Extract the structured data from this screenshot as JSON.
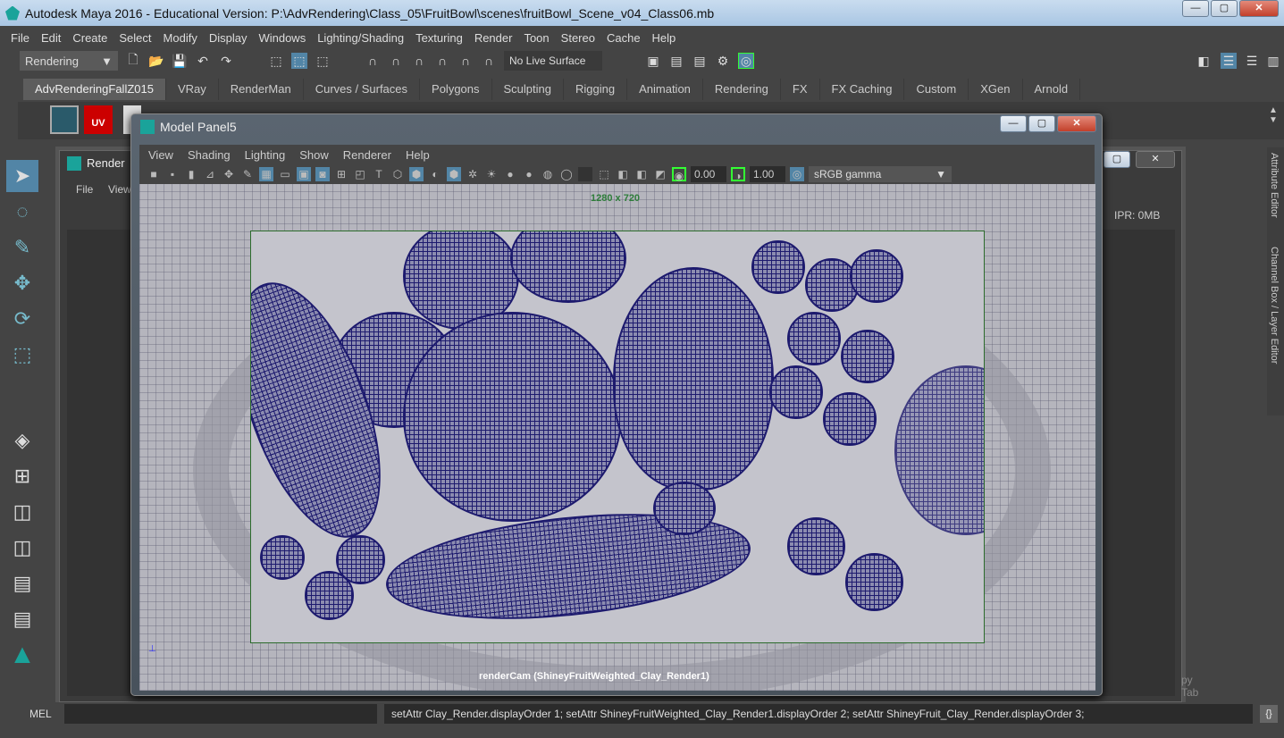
{
  "app": {
    "title": "Autodesk Maya 2016 - Educational Version: P:\\AdvRendering\\Class_05\\FruitBowl\\scenes\\fruitBowl_Scene_v04_Class06.mb"
  },
  "menu": [
    "File",
    "Edit",
    "Create",
    "Select",
    "Modify",
    "Display",
    "Windows",
    "Lighting/Shading",
    "Texturing",
    "Render",
    "Toon",
    "Stereo",
    "Cache",
    "Help"
  ],
  "toolbar": {
    "menu_set": "Rendering",
    "live_surface": "No Live Surface"
  },
  "shelf_tabs": [
    "AdvRenderingFallZ015",
    "VRay",
    "RenderMan",
    "Curves / Surfaces",
    "Polygons",
    "Sculpting",
    "Rigging",
    "Animation",
    "Rendering",
    "FX",
    "FX Caching",
    "Custom",
    "XGen",
    "Arnold"
  ],
  "render_window": {
    "title": "Render",
    "menu": [
      "File",
      "View"
    ],
    "mem": "IPR: 0MB"
  },
  "model_panel": {
    "title": "Model Panel5",
    "menu": [
      "View",
      "Shading",
      "Lighting",
      "Show",
      "Renderer",
      "Help"
    ],
    "exposure": "0.00",
    "gamma": "1.00",
    "color_space": "sRGB gamma",
    "resolution": "1280 x 720",
    "camera": "renderCam (ShineyFruitWeighted_Clay_Render1)"
  },
  "right_tabs": [
    "Attribute Editor",
    "Channel Box / Layer Editor"
  ],
  "hidden_tab": "py Tab",
  "mel": {
    "label": "MEL",
    "output": "setAttr Clay_Render.displayOrder 1; setAttr ShineyFruitWeighted_Clay_Render1.displayOrder 2; setAttr ShineyFruit_Clay_Render.displayOrder 3;"
  },
  "colors": {
    "selection": "#5285a6",
    "wireframe": "#1d1a6e",
    "gate": "#2b6b2b"
  }
}
